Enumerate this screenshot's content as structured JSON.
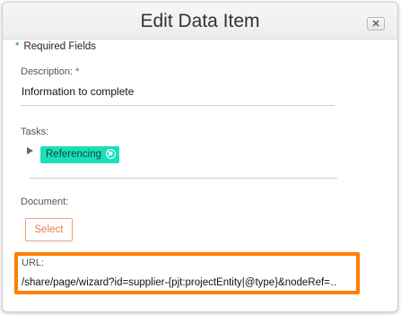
{
  "dialog": {
    "title": "Edit Data Item",
    "close_icon": "close-icon"
  },
  "required_note": {
    "asterisk": "*",
    "text": "Required Fields"
  },
  "description": {
    "label": "Description:",
    "required_mark": "*",
    "value": "Information to complete"
  },
  "tasks": {
    "label": "Tasks:",
    "expander_icon": "triangle-right-icon",
    "tags": [
      {
        "label": "Referencing",
        "remove_icon": "remove-circle-icon"
      }
    ]
  },
  "document": {
    "label": "Document:",
    "select_label": "Select"
  },
  "url": {
    "label": "URL:",
    "value": "/share/page/wizard?id=supplier-{pjt:projectEntity|@type}&nodeRef=…"
  },
  "colors": {
    "tag_bg": "#19e0ba",
    "highlight_border": "#ff7f00",
    "select_text": "#e07f4a",
    "required_asterisk": "#1f9b2e"
  }
}
